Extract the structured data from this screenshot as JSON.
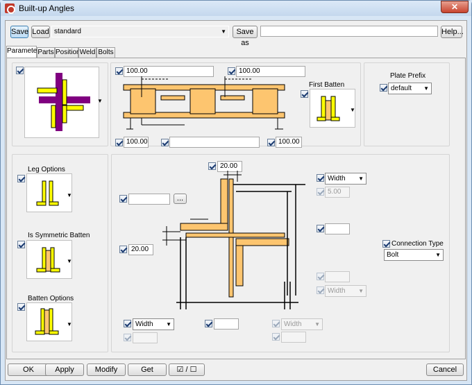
{
  "window": {
    "title": "Built-up Angles",
    "close_label": "✕"
  },
  "toolbar": {
    "save_label": "Save",
    "load_label": "Load",
    "preset_value": "standard",
    "save_as_label": "Save as",
    "save_as_value": "",
    "help_label": "Help..."
  },
  "tabs": [
    {
      "label": "Parameters"
    },
    {
      "label": "Parts"
    },
    {
      "label": "Position"
    },
    {
      "label": "Weld"
    },
    {
      "label": "Bolts"
    }
  ],
  "top": {
    "dim_left": "100.00",
    "dim_right": "100.00",
    "dim_bottom_left": "100.00",
    "dim_bottom_mid": "",
    "dim_bottom_right": "100.00",
    "first_batten_label": "First Batten",
    "plate_prefix_label": "Plate Prefix",
    "plate_prefix_value": "default"
  },
  "left": {
    "leg_options_label": "Leg Options",
    "symmetric_label": "Is Symmetric Batten",
    "batten_options_label": "Batten Options"
  },
  "detail": {
    "top_dim": "20.00",
    "left_field": "",
    "browse_label": "...",
    "left_dim": "20.00",
    "width_combo_1": "Width",
    "dim_5": "5.00",
    "mid_right_field": "",
    "connection_type_label": "Connection Type",
    "connection_type_value": "Bolt",
    "dis_field_1": "",
    "width_combo_2": "Width",
    "bottom_width_combo": "Width",
    "bottom_mid_field": "",
    "bottom_right_combo": "Width",
    "bottom_left_dis": "",
    "bottom_right_dis": ""
  },
  "footer": {
    "ok_label": "OK",
    "apply_label": "Apply",
    "modify_label": "Modify",
    "get_label": "Get",
    "toggle_label": "☑ / ☐",
    "cancel_label": "Cancel"
  },
  "colors": {
    "angle": "#ffff00",
    "purple": "#800080",
    "plate": "#fdc56f",
    "accent": "#3c7fb1"
  }
}
